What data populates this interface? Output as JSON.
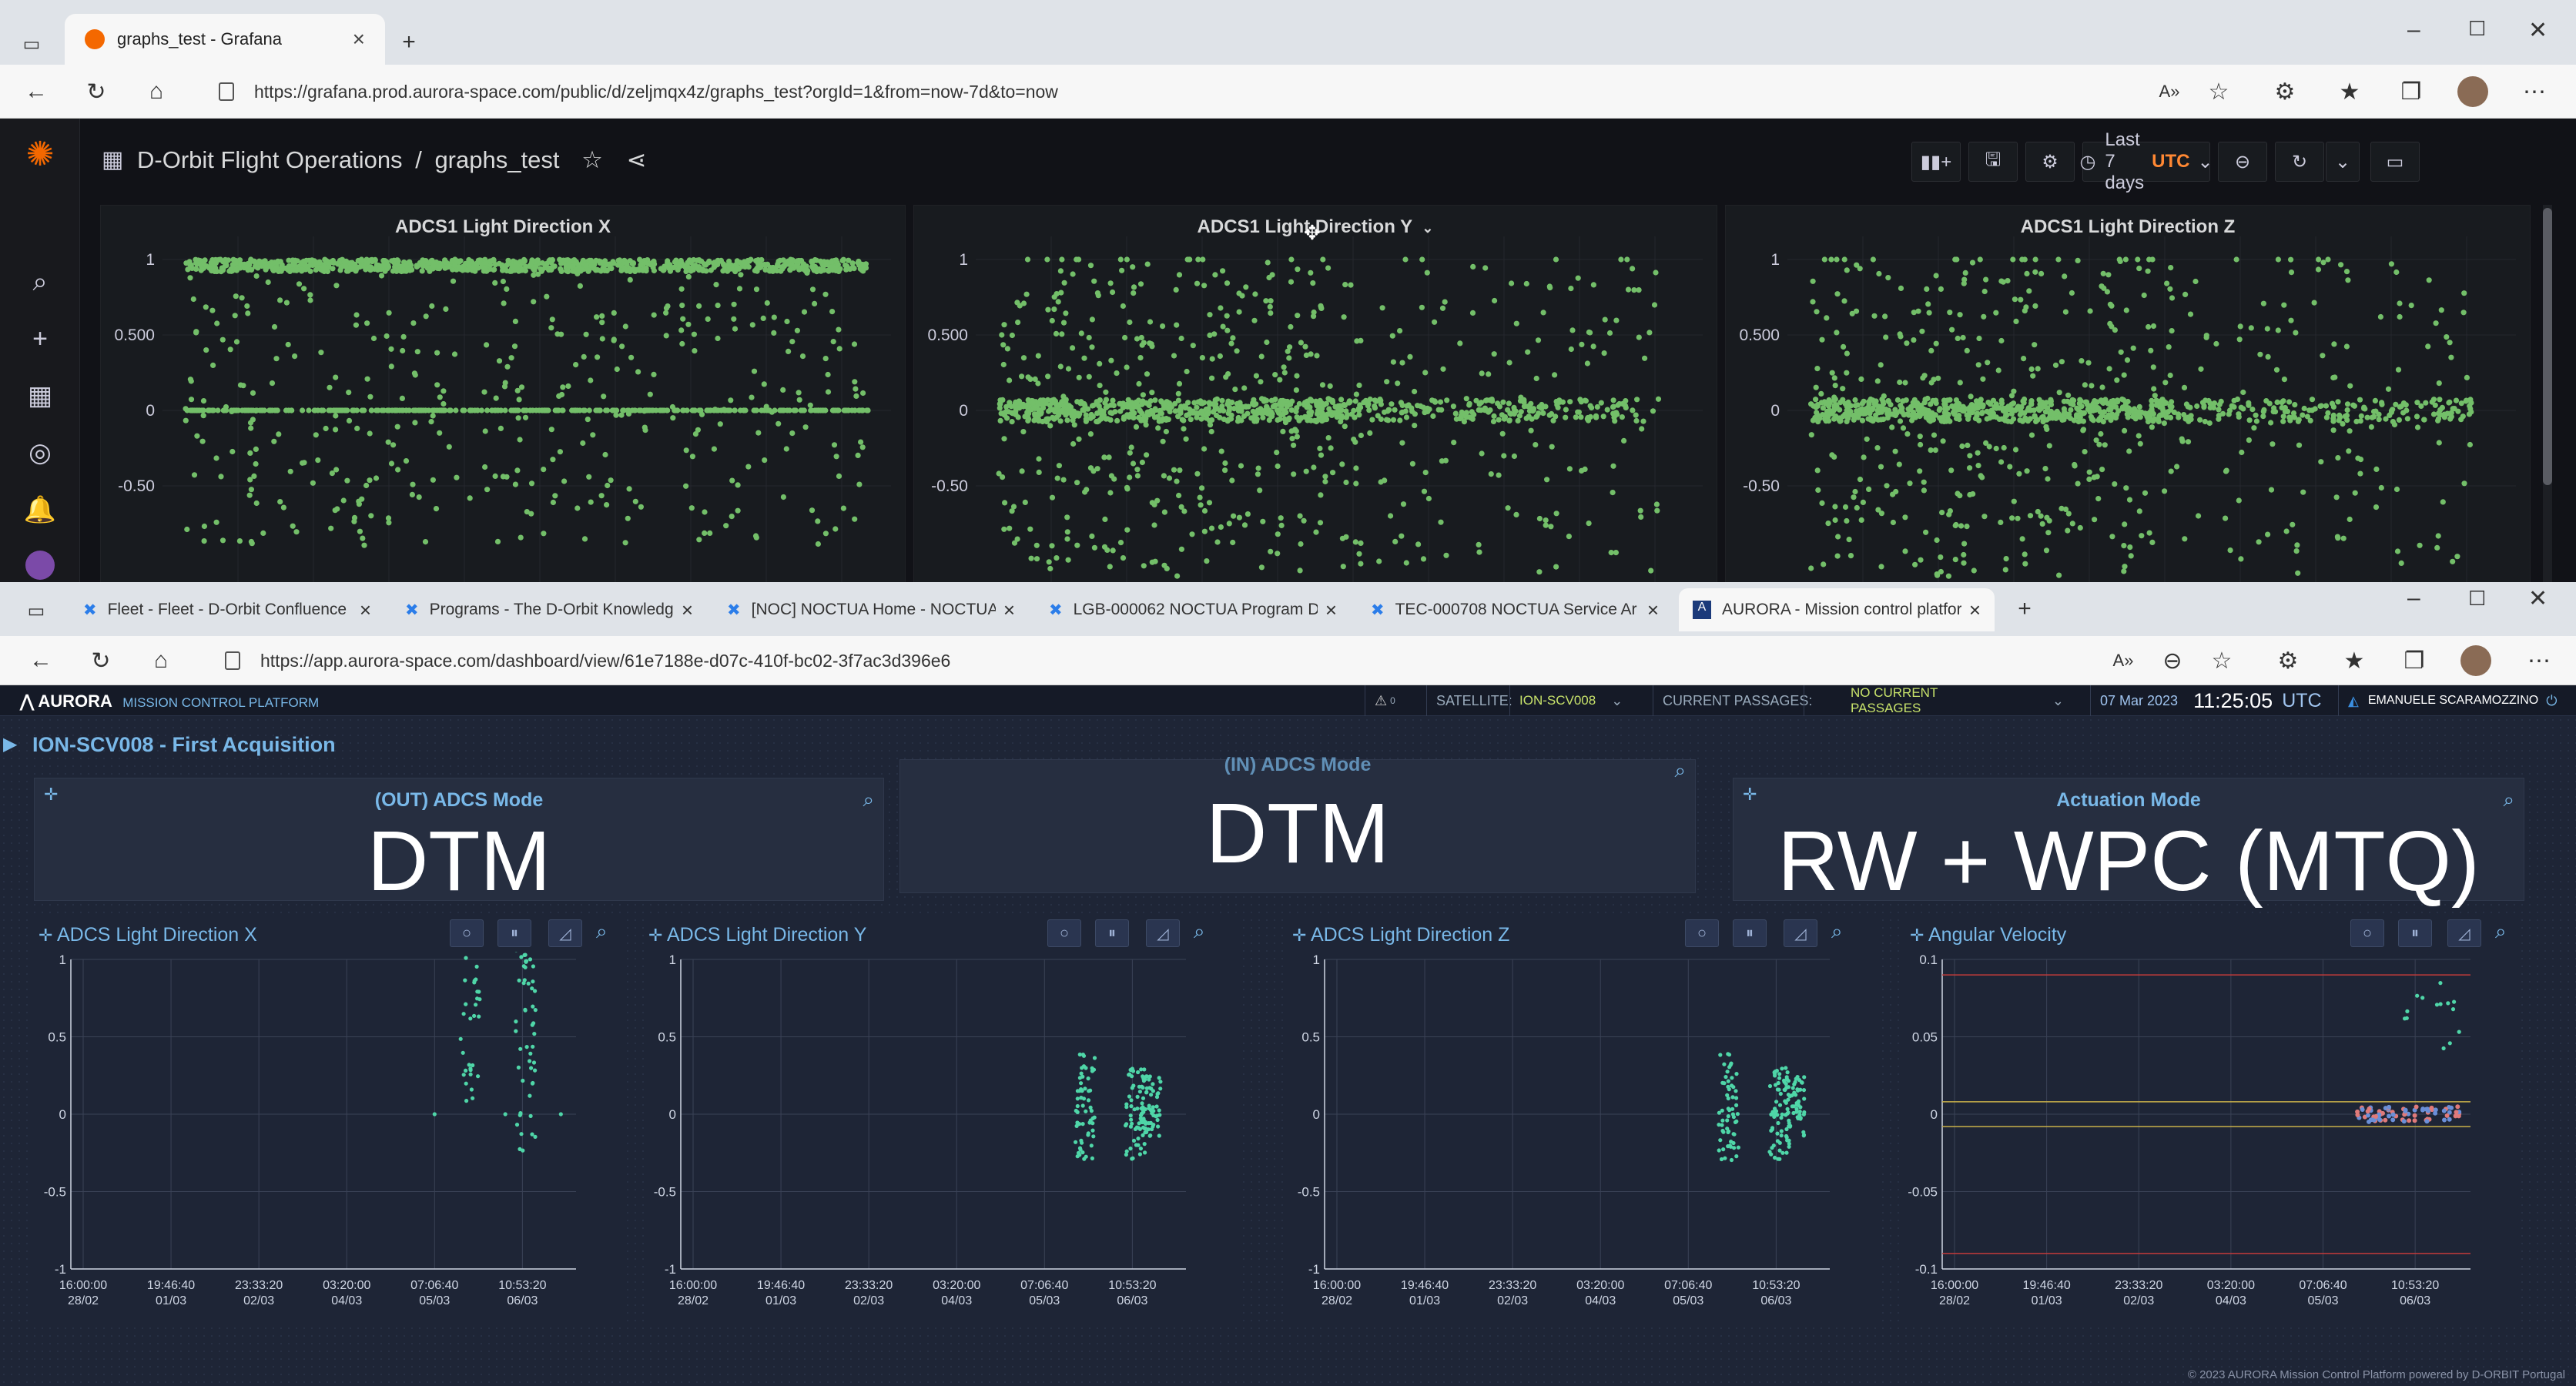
{
  "browser1": {
    "tab": {
      "title": "graphs_test - Grafana"
    },
    "url": "https://grafana.prod.aurora-space.com/public/d/zeljmqx4z/graphs_test?orgId=1&from=now-7d&to=now"
  },
  "grafana": {
    "breadcrumb": {
      "folder": "D-Orbit Flight Operations",
      "separator": "/",
      "dashboard": "graphs_test"
    },
    "time_range": {
      "label": "Last 7 days",
      "tz": "UTC"
    },
    "panels": [
      {
        "title": "ADCS1 Light Direction X"
      },
      {
        "title": "ADCS1 Light Direction Y"
      },
      {
        "title": "ADCS1 Light Direction Z"
      }
    ],
    "y_ticks": [
      "1",
      "0.500",
      "0",
      "-0.50"
    ],
    "series_color": "#73bf69"
  },
  "browser2": {
    "tabs": [
      {
        "title": "Fleet - Fleet - D-Orbit Confluence"
      },
      {
        "title": "Programs - The D-Orbit Knowledge"
      },
      {
        "title": "[NOC] NOCTUA Home - NOCTUA"
      },
      {
        "title": "LGB-000062 NOCTUA Program D"
      },
      {
        "title": "TEC-000708 NOCTUA Service Ar"
      },
      {
        "title": "AURORA - Mission control platform"
      }
    ],
    "url": "https://app.aurora-space.com/dashboard/view/61e7188e-d07c-410f-bc02-3f7ac3d396e6"
  },
  "aurora": {
    "brand": "AURORA",
    "subtitle": "MISSION CONTROL PLATFORM",
    "alert_count": "0",
    "satellite_label": "SATELLITE:",
    "satellite": "ION-SCV008",
    "passages_label": "CURRENT PASSAGES:",
    "passages": "NO CURRENT PASSAGES",
    "date": "07 Mar 2023",
    "time": "11:25:05",
    "tz": "UTC",
    "user": "EMANUELE SCARAMOZZINO",
    "dashboard_title": "ION-SCV008 - First Acquisition",
    "modes": [
      {
        "title": "(OUT) ADCS Mode",
        "value": "DTM"
      },
      {
        "title": "(IN) ADCS Mode",
        "value": "DTM"
      },
      {
        "title": "Actuation Mode",
        "value": "RW + WPC (MTQ)"
      }
    ],
    "graphs": [
      {
        "title": "ADCS Light Direction X",
        "y_ticks": [
          "1",
          "0.5",
          "0",
          "-0.5",
          "-1"
        ]
      },
      {
        "title": "ADCS Light Direction Y",
        "y_ticks": [
          "1",
          "0.5",
          "0",
          "-0.5",
          "-1"
        ]
      },
      {
        "title": "ADCS Light Direction Z",
        "y_ticks": [
          "1",
          "0.5",
          "0",
          "-0.5",
          "-1"
        ]
      },
      {
        "title": "Angular Velocity",
        "y_ticks": [
          "0.1",
          "0.05",
          "0",
          "-0.05",
          "-0.1"
        ]
      }
    ],
    "x_ticks": [
      {
        "time": "16:00:00",
        "date": "28/02"
      },
      {
        "time": "19:46:40",
        "date": "01/03"
      },
      {
        "time": "23:33:20",
        "date": "02/03"
      },
      {
        "time": "03:20:00",
        "date": "04/03"
      },
      {
        "time": "07:06:40",
        "date": "05/03"
      },
      {
        "time": "10:53:20",
        "date": "06/03"
      }
    ],
    "series_color": "#4fd6a8",
    "footer": "© 2023 AURORA Mission Control Platform powered by D-ORBIT Portugal"
  }
}
